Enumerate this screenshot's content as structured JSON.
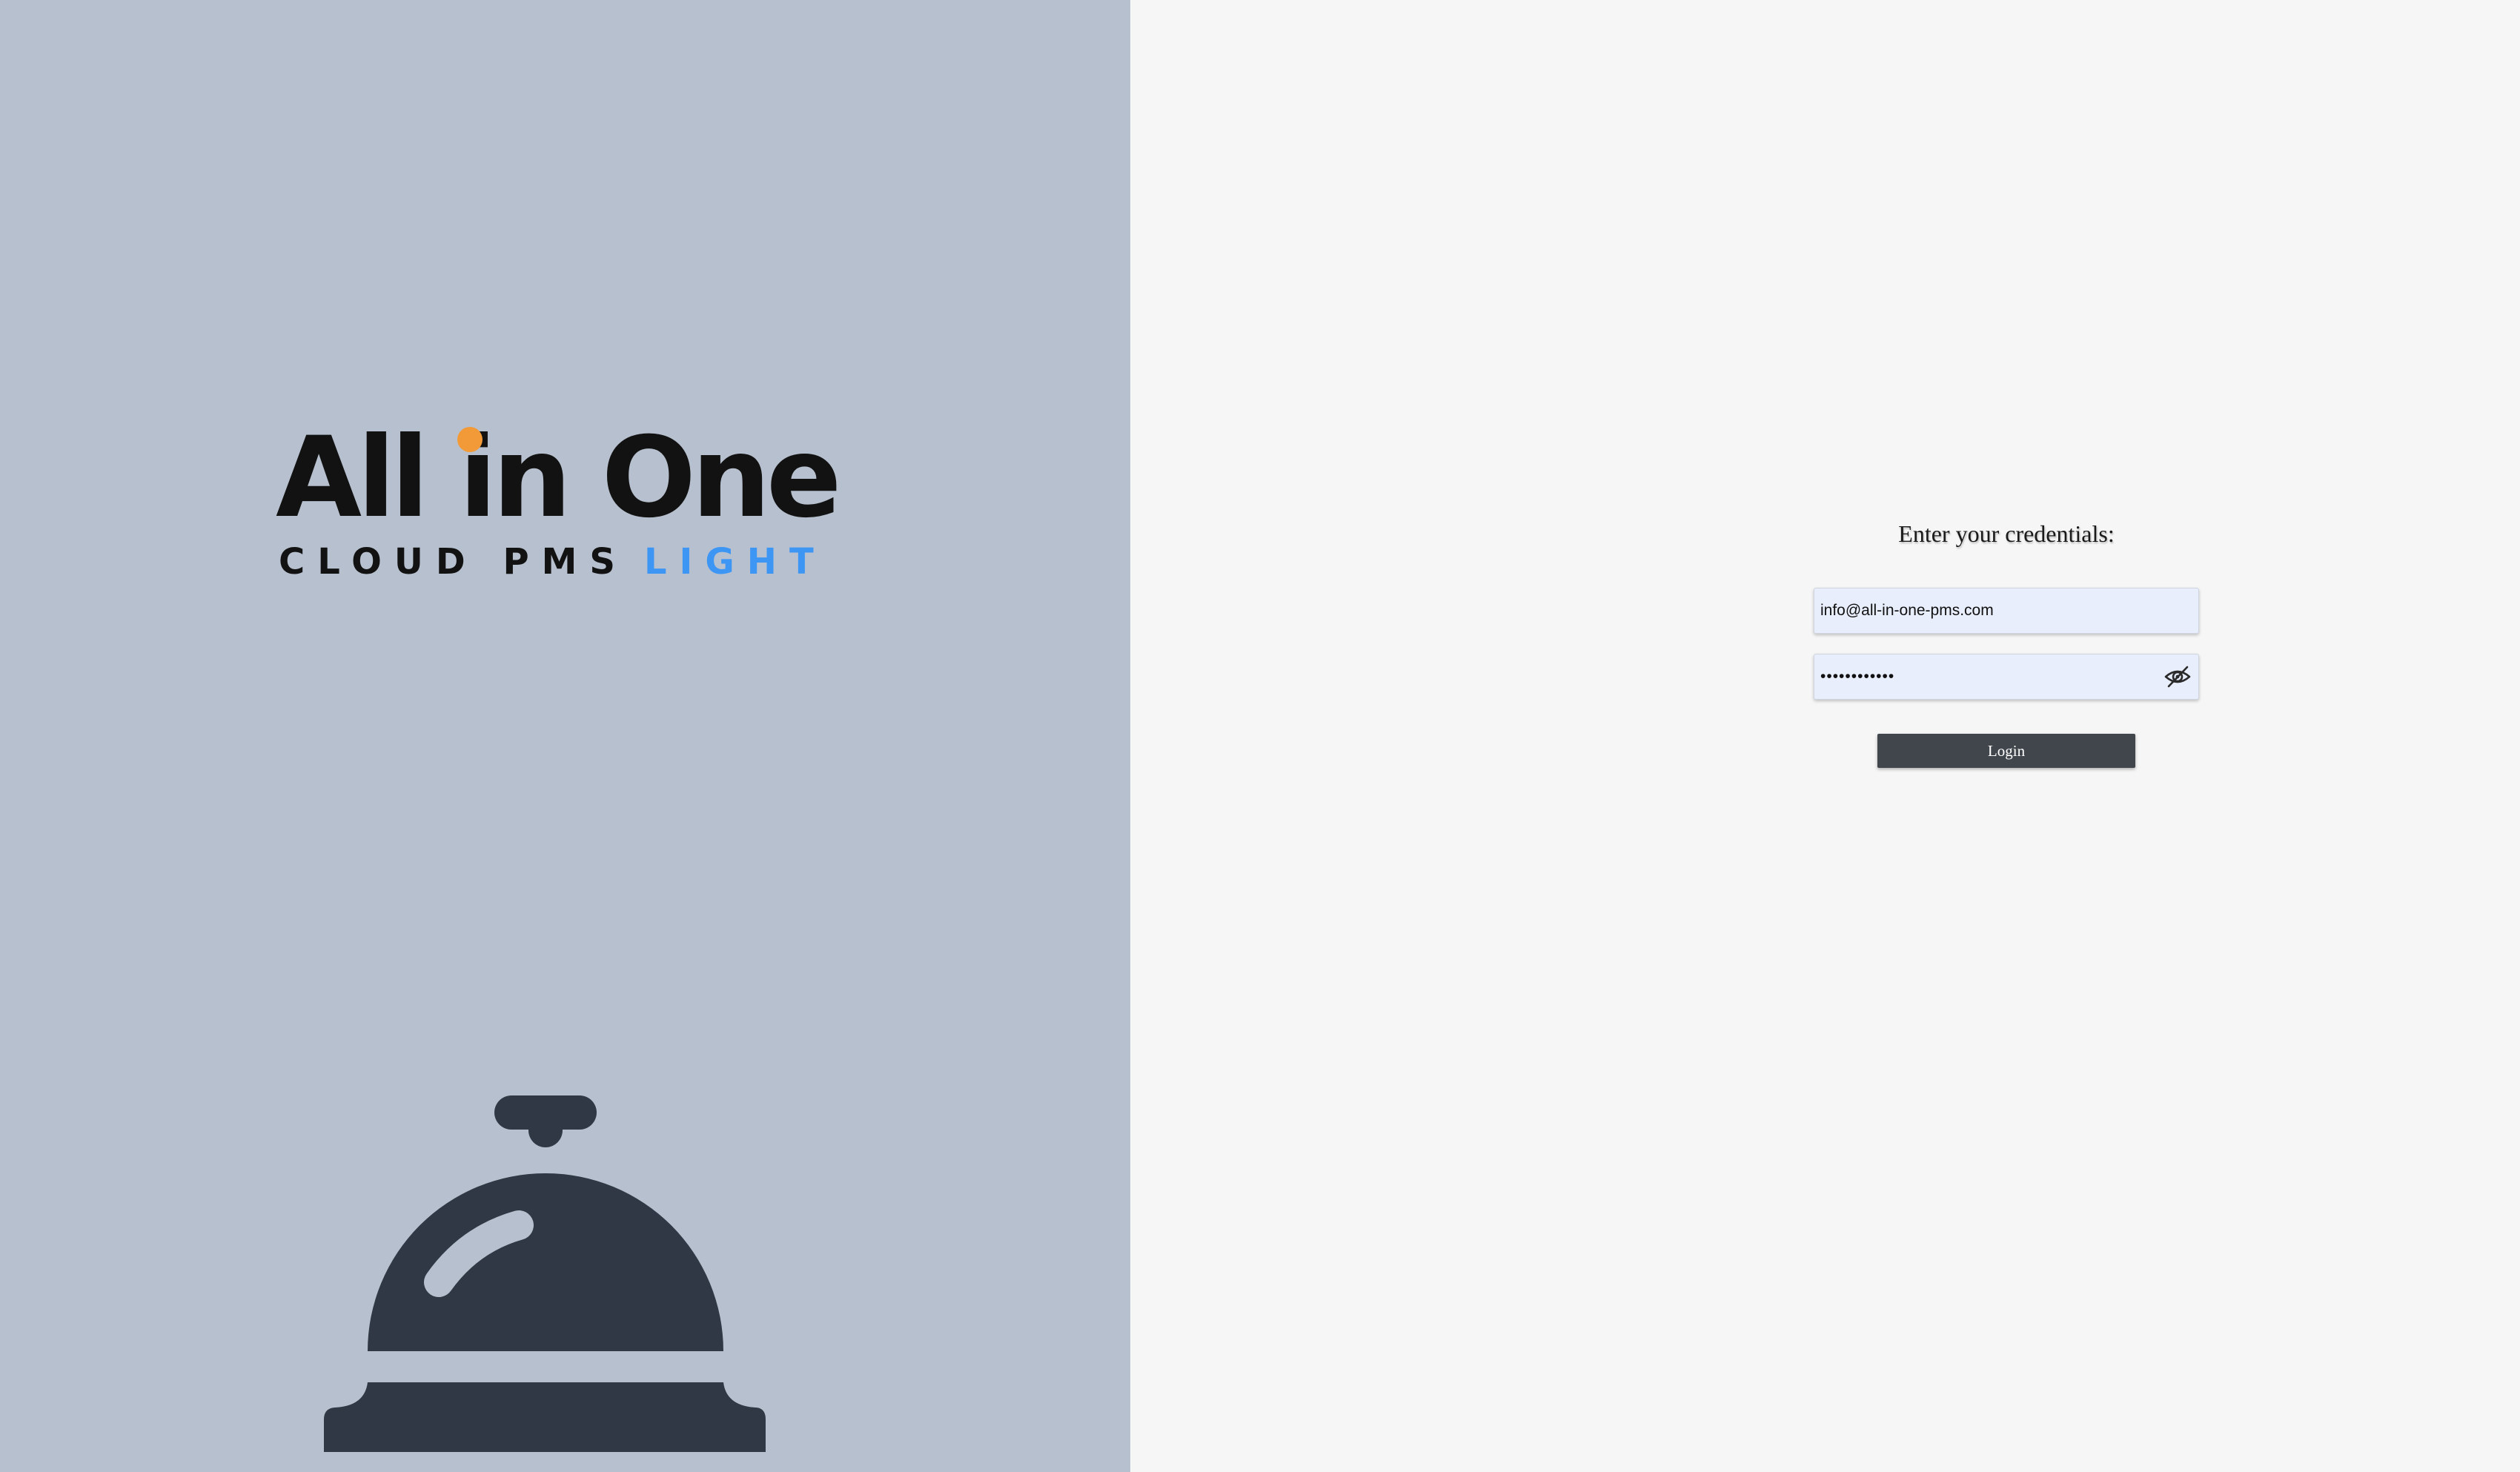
{
  "brand": {
    "name": "All in One",
    "tagline_dark": "CLOUD PMS",
    "tagline_accent": "LIGHT",
    "colors": {
      "left_panel_bg": "#b7c0ce",
      "right_panel_bg": "#f6f6f6",
      "logo_text": "#121212",
      "logo_dot": "#f29a38",
      "tagline_accent": "#3d95f4",
      "bell": "#2f3844"
    },
    "illustration_icon": "service-bell-icon"
  },
  "login": {
    "title": "Enter your credentials:",
    "email": {
      "value": "info@all-in-one-pms.com",
      "placeholder": ""
    },
    "password": {
      "value": "••••••••••••",
      "toggle_icon": "eye-slash-icon"
    },
    "submit_label": "Login",
    "colors": {
      "input_bg": "#e8eefc",
      "button_bg": "#41464d",
      "button_text": "#ffffff"
    }
  }
}
